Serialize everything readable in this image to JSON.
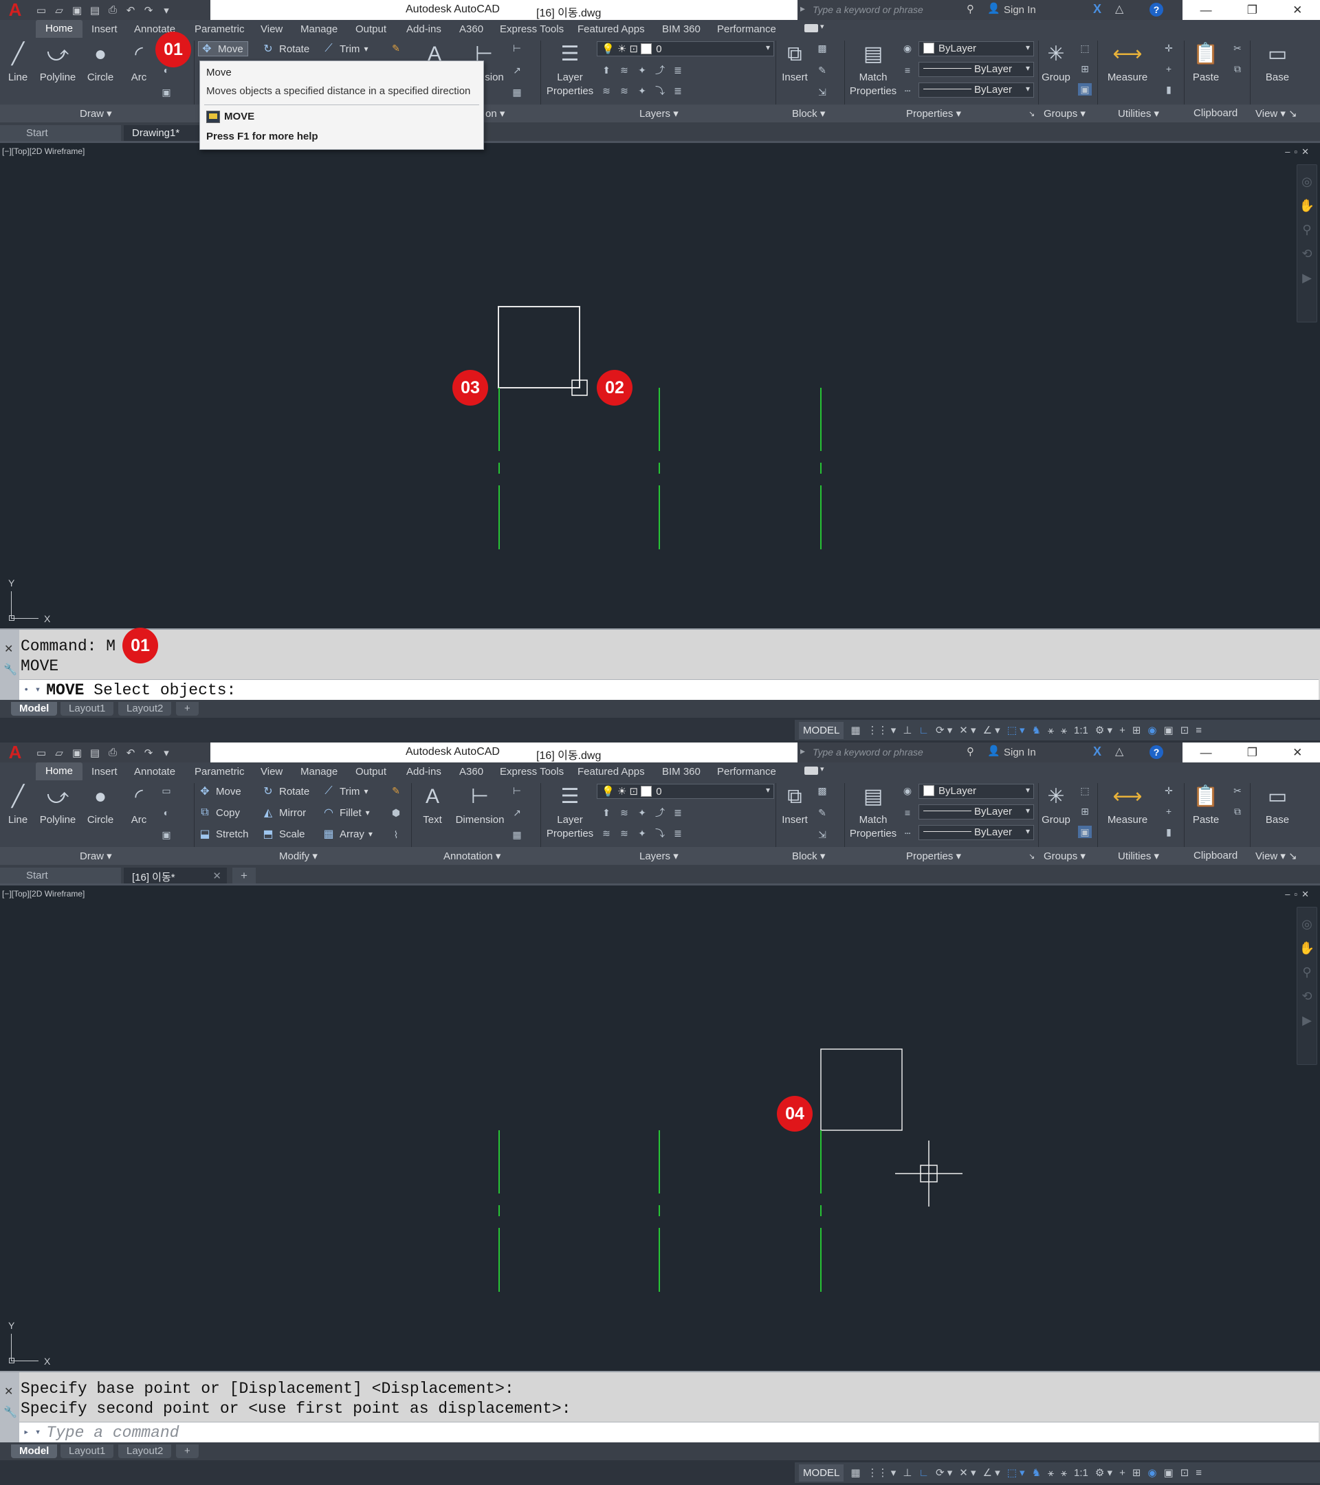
{
  "app": {
    "title": "Autodesk AutoCAD",
    "file_shot1": "[16] 이동.dwg",
    "file_shot2": "[16] 이동.dwg",
    "search_placeholder": "Type a keyword or phrase",
    "sign_in": "Sign In"
  },
  "ribbon_tabs": [
    "Home",
    "Insert",
    "Annotate",
    "Parametric",
    "View",
    "Manage",
    "Output",
    "Add-ins",
    "A360",
    "Express Tools",
    "Featured Apps",
    "BIM 360",
    "Performance"
  ],
  "panels": {
    "draw": {
      "title": "Draw",
      "line": "Line",
      "polyline": "Polyline",
      "circle": "Circle",
      "arc": "Arc"
    },
    "modify": {
      "title": "Modify",
      "move": "Move",
      "rotate": "Rotate",
      "trim": "Trim",
      "copy": "Copy",
      "mirror": "Mirror",
      "fillet": "Fillet",
      "stretch": "Stretch",
      "scale": "Scale",
      "array": "Array"
    },
    "annotation": {
      "title": "Annotation",
      "text": "Text",
      "dimension": "Dimension",
      "dimension_partial": "sion",
      "title_partial": "on"
    },
    "layers": {
      "title": "Layers",
      "layer_properties_1": "Layer",
      "layer_properties_2": "Properties",
      "current_layer": "0"
    },
    "block": {
      "title": "Block",
      "insert": "Insert"
    },
    "properties": {
      "title": "Properties",
      "match_1": "Match",
      "match_2": "Properties",
      "color": "ByLayer",
      "linetype": "ByLayer",
      "lineweight": "ByLayer"
    },
    "groups": {
      "title": "Groups",
      "group": "Group"
    },
    "utilities": {
      "title": "Utilities",
      "measure": "Measure"
    },
    "clipboard": {
      "title": "Clipboard",
      "paste": "Paste"
    },
    "view": {
      "title": "View",
      "base": "Base"
    }
  },
  "doc_tabs": {
    "start": "Start",
    "shot1_current": "Drawing1*",
    "shot2_current": "[16] 이동*"
  },
  "viewport": {
    "label": "[−][Top][2D Wireframe]",
    "axis_x": "X",
    "axis_y": "Y"
  },
  "tooltip": {
    "title": "Move",
    "description": "Moves objects a specified distance in a specified direction",
    "command": "MOVE",
    "help": "Press F1 for more help"
  },
  "command_line": {
    "shot1_history_1": "Command: M",
    "shot1_history_2": "MOVE",
    "shot1_prompt_cmd": "MOVE",
    "shot1_prompt_text": "Select objects:",
    "shot2_history_1": "Specify base point or [Displacement] <Displacement>:",
    "shot2_history_2": "Specify second point or <use first point as displacement>:",
    "shot2_placeholder": "Type a command"
  },
  "layout_tabs": [
    "Model",
    "Layout1",
    "Layout2"
  ],
  "status": {
    "model": "MODEL",
    "scale": "1:1"
  },
  "callouts": {
    "c01": "01",
    "c02": "02",
    "c03": "03",
    "c04": "04"
  },
  "colors": {
    "accent_red": "#e0161a",
    "drawing_green": "#27c435",
    "viewport_bg": "#212830"
  }
}
